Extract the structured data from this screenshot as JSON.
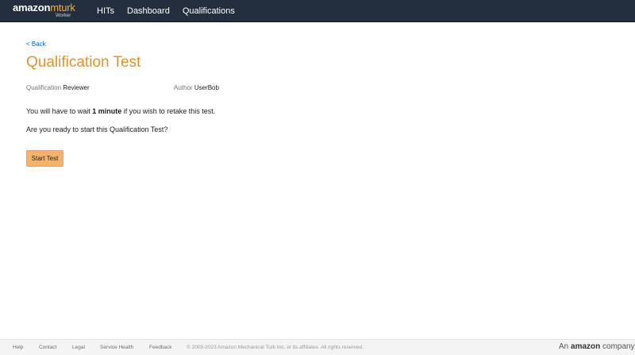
{
  "header": {
    "logo": {
      "amazon": "amazon",
      "mturk": "mturk",
      "sub": "Worker"
    },
    "nav": [
      "HITs",
      "Dashboard",
      "Qualifications"
    ]
  },
  "main": {
    "back_label": "< Back",
    "title": "Qualification Test",
    "qualification_label": "Qualification",
    "qualification_value": "Reviewer",
    "author_label": "Author",
    "author_value": "UserBob",
    "wait_prefix": "You will have to wait ",
    "wait_time": "1 minute",
    "wait_suffix": " if you wish to retake this test.",
    "ready_text": "Are you ready to start this Qualification Test?",
    "start_button": "Start Test"
  },
  "footer": {
    "links": [
      "Help",
      "Contact",
      "Legal",
      "Service Health",
      "Feedback"
    ],
    "copyright": "© 2005-2023 Amazon Mechanical Turk Inc. or its affiliates. All rights reserved.",
    "company_prefix": "An",
    "company_brand": "amazon",
    "company_suffix": "company"
  },
  "colors": {
    "navbar": "#232f3e",
    "title": "#e3922f",
    "link": "#0066c0",
    "button": "#f3b36b"
  }
}
